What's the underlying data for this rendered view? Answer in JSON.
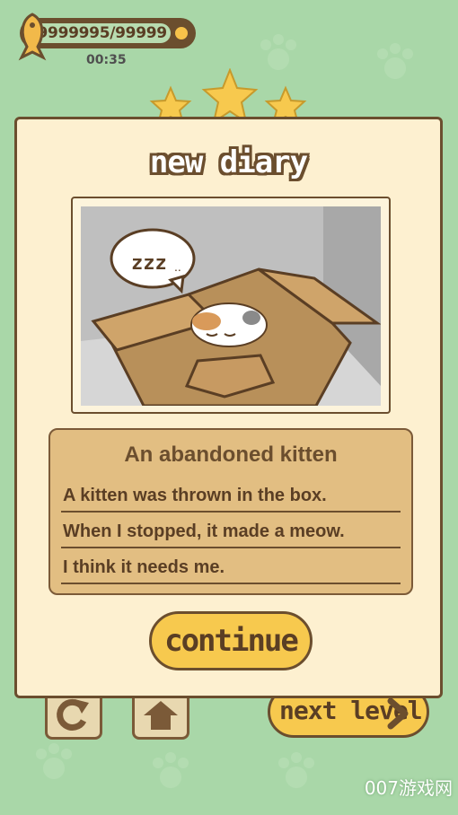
{
  "hud": {
    "fish_count": "99999995/99999",
    "timer": "00:35",
    "icon": "fish-icon",
    "add_icon": "plus-icon"
  },
  "background": {
    "restart_icon": "restart-icon",
    "home_icon": "home-icon",
    "next_level_label": "next level"
  },
  "diary": {
    "title": "new diary",
    "photo": "sleeping-kitten-in-box",
    "story_title": "An abandoned kitten",
    "lines": [
      "A kitten was thrown in the box.",
      "When I stopped, it made a meow.",
      "I think it needs me."
    ],
    "continue_label": "continue",
    "speech_bubble": "z z z . . ."
  },
  "watermark": "007游戏网",
  "colors": {
    "background": "#a9d7a8",
    "card": "#fdf0d0",
    "text_box": "#e2be82",
    "button": "#f7c94e",
    "outline": "#6b4e2e"
  }
}
